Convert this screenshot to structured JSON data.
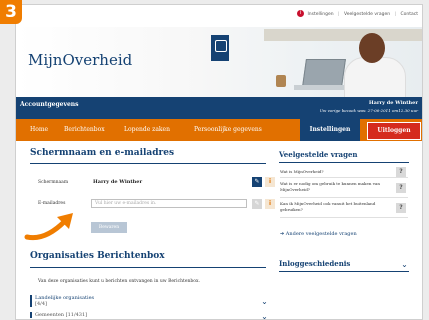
{
  "step_badge": "3",
  "top_links": [
    "Instellingen",
    "Veelgestelde vragen",
    "Contact"
  ],
  "site_name": "MijnOverheid",
  "account_bar": {
    "title": "Accountgegevens",
    "user_name": "Harry de Winther",
    "last_visit": "Uw vorige bezoek was: 27-06-2011 om12.30 uur"
  },
  "nav": {
    "items": [
      "Home",
      "Berichtenbox",
      "Lopende zaken",
      "Persoonlijke gegevens"
    ],
    "settings": "Instellingen",
    "logout": "Uitloggen"
  },
  "account_form": {
    "heading": "Schermnaam en e-mailadres",
    "screen_name_label": "Schermnaam",
    "screen_name_value": "Harry de Winther",
    "email_label": "E-mailadres",
    "email_placeholder": "Vul hier uw e-mailadres in.",
    "save_button": "Bewaren"
  },
  "faq": {
    "heading": "Veelgestelde vragen",
    "questions": [
      "Wat is MijnOverheid?",
      "Wat is er nodig om gebruik te kunnen maken van MijnOverheid?",
      "Kan ik MijnOverheid ook vanuit het buitenland gebruiken?"
    ],
    "more": "Andere veelgestelde vragen"
  },
  "login_history": {
    "heading": "Inloggeschiedenis"
  },
  "organisations": {
    "heading": "Organisaties Berichtenbox",
    "intro": "Van deze organisaties kunt u berichten ontvangen in uw Berichtenbox.",
    "groups": [
      {
        "name": "Landelijke organisaties",
        "count": "[4/4]"
      },
      {
        "name": "Gemeenten",
        "count": "[11/431]"
      }
    ]
  },
  "colors": {
    "primary": "#154273",
    "accent": "#e17000",
    "danger": "#d52b1e"
  }
}
